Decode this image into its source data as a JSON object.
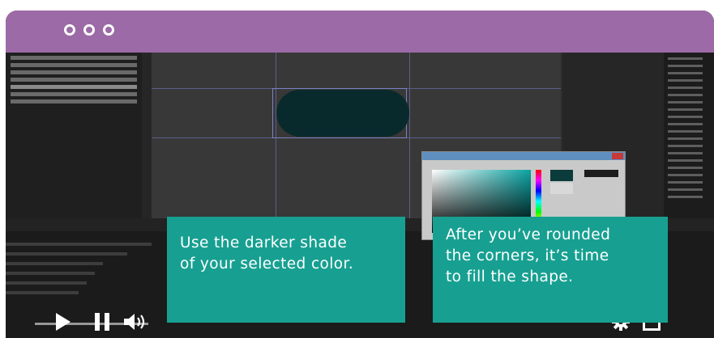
{
  "window": {
    "titlebar_color": "#9c6aa6",
    "traffic_dots": [
      "dot",
      "dot",
      "dot"
    ]
  },
  "captions": {
    "left": [
      "Use the darker shade",
      "of your selected color."
    ],
    "right": [
      "After you’ve rounded",
      "the corners, it’s time",
      "to fill the shape."
    ],
    "background_color": "#17a091"
  },
  "editor": {
    "shape_fill": "#092a2d",
    "color_picker_target": "#0aa3a3"
  },
  "player": {
    "icons": [
      "play-icon",
      "pause-icon",
      "volume-icon",
      "settings-gear-icon",
      "fullscreen-icon"
    ]
  }
}
